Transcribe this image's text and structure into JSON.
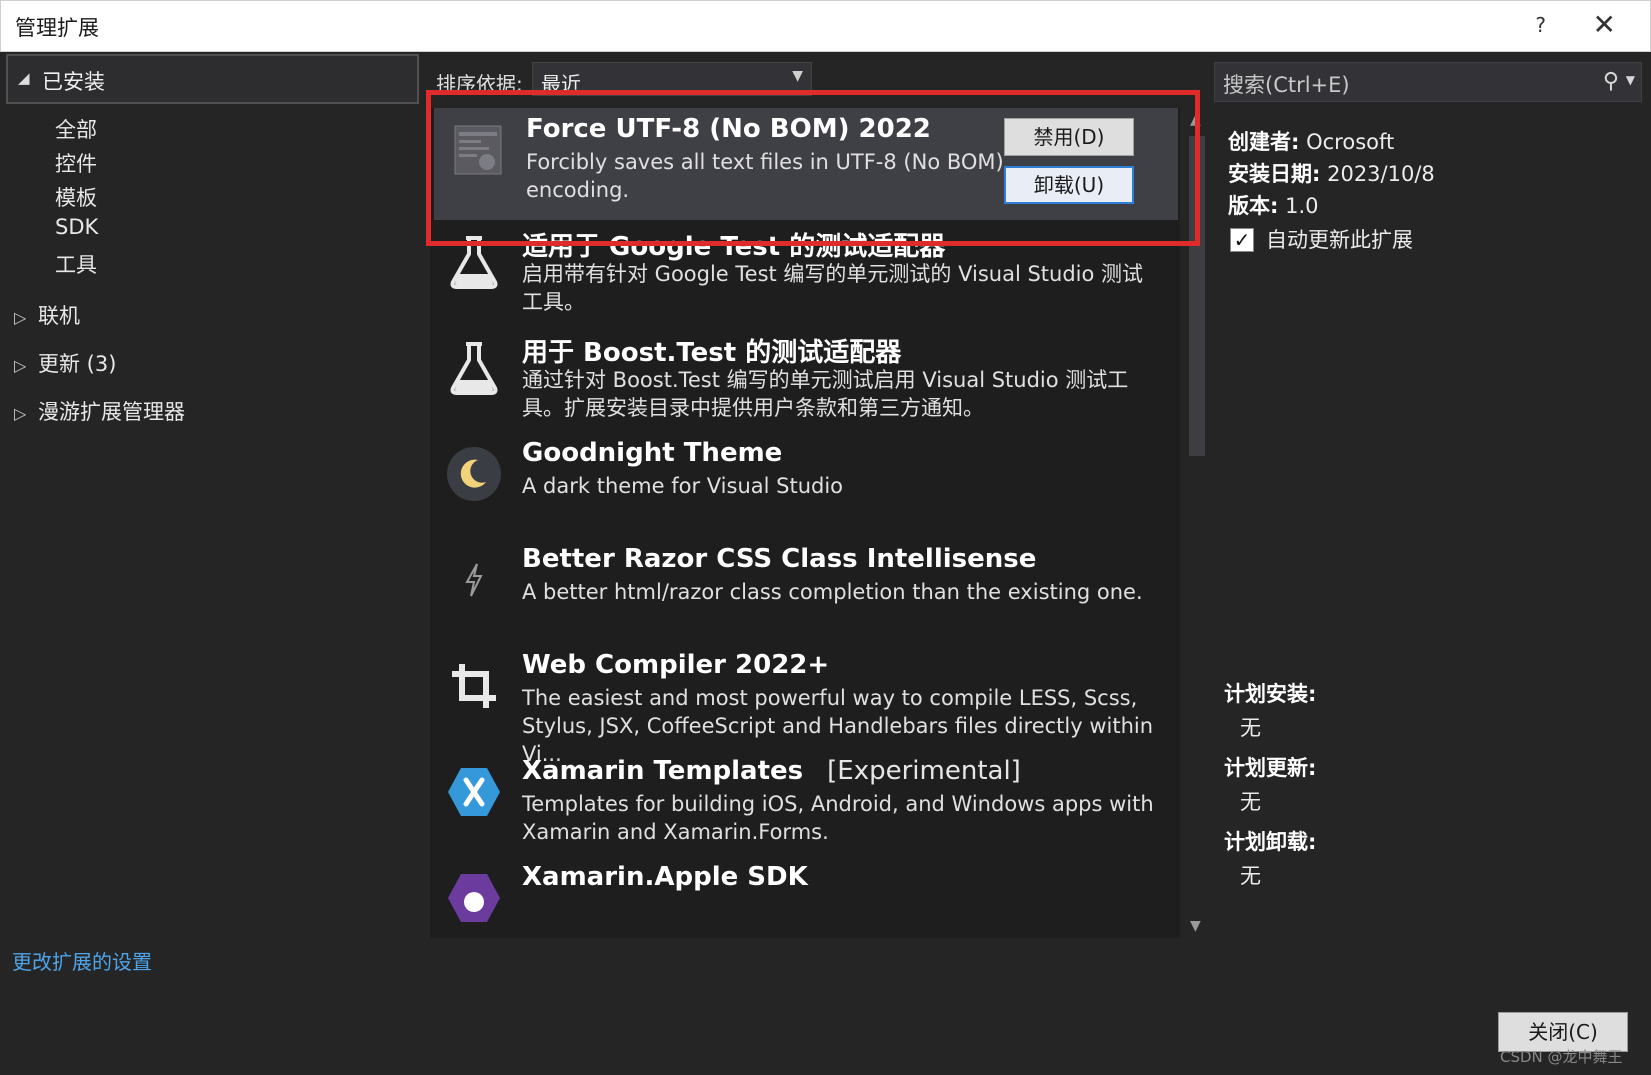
{
  "window": {
    "title": "管理扩展",
    "help": "?",
    "close": "✕"
  },
  "left": {
    "installed": {
      "toggle": "◢",
      "label": "已安装"
    },
    "categories": [
      "全部",
      "控件",
      "模板",
      "SDK",
      "工具"
    ],
    "groups": [
      {
        "arrow": "▷",
        "label": "联机"
      },
      {
        "arrow": "▷",
        "label": "更新 (3)"
      },
      {
        "arrow": "▷",
        "label": "漫游扩展管理器"
      }
    ]
  },
  "sort": {
    "label": "排序依据:",
    "value": "最近"
  },
  "extensions": [
    {
      "name": "Force UTF-8 (No BOM) 2022",
      "desc": "Forcibly saves all text files in UTF-8 (No BOM) encoding.",
      "icon": "document-icon"
    },
    {
      "name": "适用于 Google Test 的测试适配器",
      "desc": "启用带有针对 Google Test 编写的单元测试的 Visual Studio 测试工具。",
      "icon": "flask-icon"
    },
    {
      "name": "用于 Boost.Test 的测试适配器",
      "desc": "通过针对 Boost.Test 编写的单元测试启用 Visual Studio 测试工具。扩展安装目录中提供用户条款和第三方通知。",
      "icon": "flask-icon"
    },
    {
      "name": "Goodnight Theme",
      "desc": "A dark theme for Visual Studio",
      "icon": "moon-icon"
    },
    {
      "name": "Better Razor CSS Class Intellisense",
      "desc": "A better html/razor class completion than the existing one.",
      "icon": "lightning-icon"
    },
    {
      "name": "Web Compiler 2022+",
      "desc": "The easiest and most powerful way to compile LESS, Scss, Stylus, JSX, CoffeeScript and Handlebars files directly within Vi...",
      "icon": "crop-icon"
    },
    {
      "name": "Xamarin Templates",
      "tag": "[Experimental]",
      "desc": "Templates for building iOS, Android, and Windows apps with Xamarin and Xamarin.Forms.",
      "icon": "xamarin-icon"
    },
    {
      "name": "Xamarin.Apple SDK",
      "desc": "",
      "icon": "apple-icon"
    }
  ],
  "selected_actions": {
    "disable": "禁用(D)",
    "uninstall": "卸载(U)"
  },
  "details": {
    "search_placeholder": "搜索(Ctrl+E)",
    "author_label": "创建者:",
    "author": "Ocrosoft",
    "date_label": "安装日期:",
    "date": "2023/10/8",
    "version_label": "版本:",
    "version": "1.0",
    "auto_update": "自动更新此扩展",
    "auto_update_checked": true,
    "plan_install_label": "计划安装:",
    "plan_install": "无",
    "plan_update_label": "计划更新:",
    "plan_update": "无",
    "plan_uninstall_label": "计划卸载:",
    "plan_uninstall": "无"
  },
  "footer": {
    "settings_link": "更改扩展的设置",
    "close_button": "关闭(C)",
    "watermark": "CSDN @龙中舞王"
  },
  "colors": {
    "highlight_box": "#e02b2b",
    "link": "#4fa3e8",
    "selected_row": "#3f3f46"
  }
}
